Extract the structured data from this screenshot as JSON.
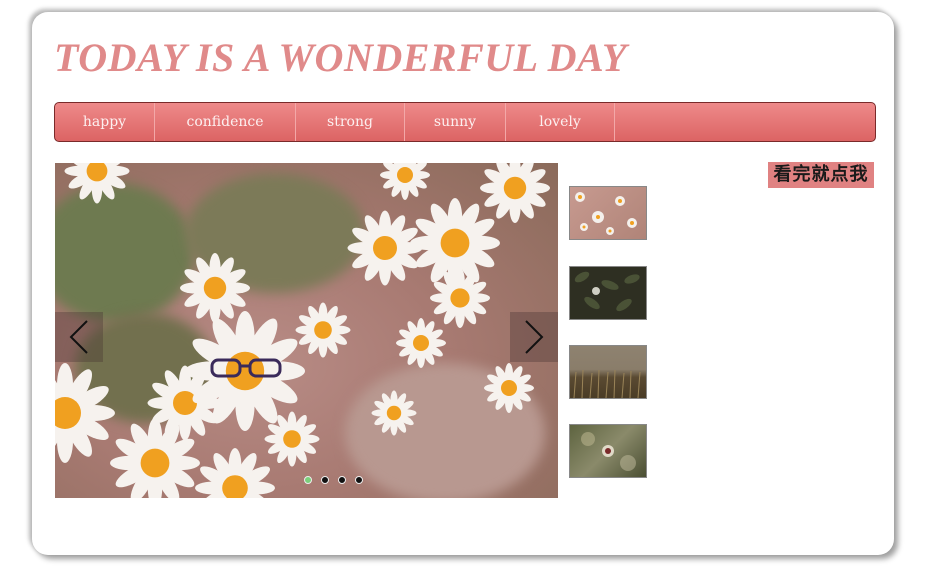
{
  "page": {
    "title": "TODAY IS A WONDERFUL DAY"
  },
  "nav": {
    "items": [
      {
        "label": "happy"
      },
      {
        "label": "confidence"
      },
      {
        "label": "strong"
      },
      {
        "label": "sunny"
      },
      {
        "label": "lovely"
      }
    ]
  },
  "slider": {
    "active_slide": 1,
    "slide_count": 4,
    "prev_icon": "chevron-left-icon",
    "next_icon": "chevron-right-icon"
  },
  "sidebar": {
    "button_label": "看完就点我",
    "thumbnails": [
      {
        "name": "daisy-field"
      },
      {
        "name": "dark-leaves"
      },
      {
        "name": "wheat-field"
      },
      {
        "name": "flower-bokeh"
      }
    ]
  },
  "colors": {
    "title": "#e08a8a",
    "nav_bar": "#e07070",
    "active_dot": "#7bd07b",
    "cta_background": "#e08282"
  }
}
